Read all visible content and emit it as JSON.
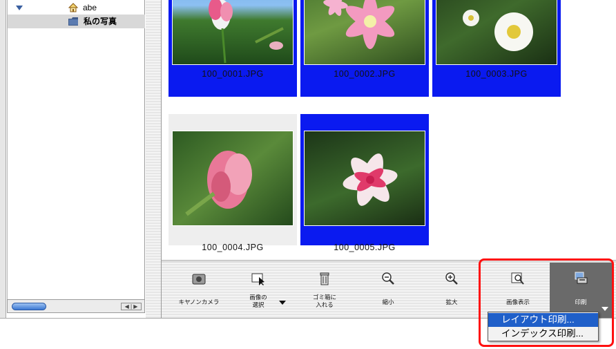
{
  "sidebar": {
    "tree": [
      {
        "label": "abe",
        "icon": "house-icon",
        "expanded": true
      },
      {
        "label": "私の写真",
        "icon": "folder-icon",
        "selected": true
      }
    ],
    "scroll_arrows": "◀ | ▶"
  },
  "thumbnails": [
    {
      "filename": "100_0001.JPG",
      "selected": true
    },
    {
      "filename": "100_0002.JPG",
      "selected": true
    },
    {
      "filename": "100_0003.JPG",
      "selected": true
    },
    {
      "filename": "100_0004.JPG",
      "selected": false
    },
    {
      "filename": "100_0005.JPG",
      "selected": true
    }
  ],
  "toolbar": {
    "canon_camera": "キヤノンカメラ",
    "select_images_line1": "画像の",
    "select_images_line2": "選択",
    "trash_line1": "ゴミ箱に",
    "trash_line2": "入れる",
    "zoom_out": "縮小",
    "zoom_in": "拡大",
    "view_image": "画像表示",
    "print": "印刷"
  },
  "print_menu": {
    "items": [
      "レイアウト印刷...",
      "インデックス印刷..."
    ],
    "highlighted_index": 0
  },
  "colors": {
    "selection": "#0a1af0",
    "highlight_box": "#ff1010",
    "menu_highlight": "#1f5fc9"
  }
}
